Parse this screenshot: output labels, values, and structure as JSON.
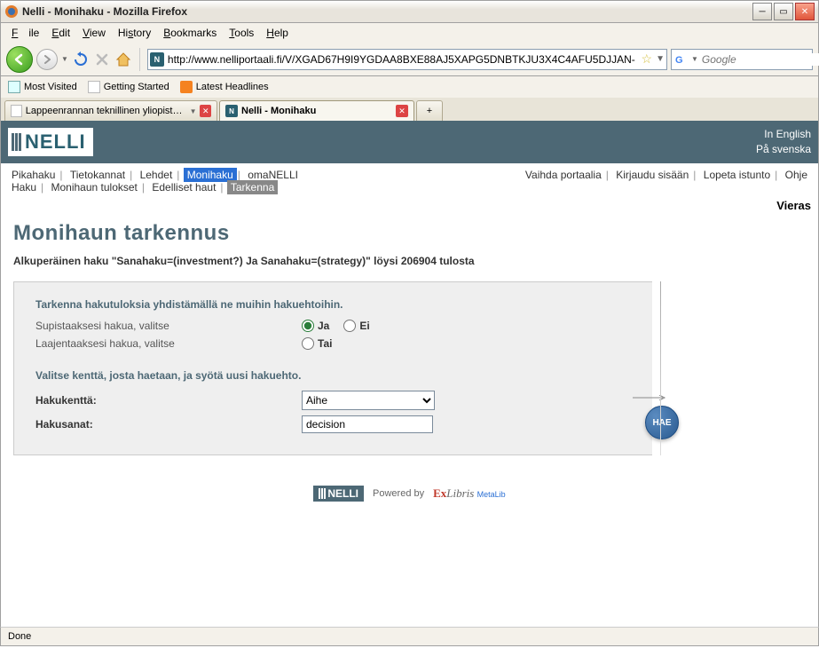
{
  "window": {
    "title": "Nelli - Monihaku - Mozilla Firefox",
    "menus": {
      "file": "File",
      "edit": "Edit",
      "view": "View",
      "history": "History",
      "bookmarks": "Bookmarks",
      "tools": "Tools",
      "help": "Help"
    },
    "url": "http://www.nelliportaali.fi/V/XGAD67H9I9YGDAA8BXE88AJ5XAPG5DNBTKJU3X4C4AFU5DJJAN-",
    "search_placeholder": "Google",
    "bookmarks": {
      "most_visited": "Most Visited",
      "getting_started": "Getting Started",
      "latest_headlines": "Latest Headlines"
    },
    "tabs": {
      "t1": "Lappeenrannan teknillinen yliopisto - Te...",
      "t2": "Nelli - Monihaku"
    },
    "status": "Done"
  },
  "header": {
    "logo": "NELLI",
    "lang_en": "In English",
    "lang_sv": "På svenska"
  },
  "nav": {
    "main": {
      "pikahaku": "Pikahaku",
      "tietokannat": "Tietokannat",
      "lehdet": "Lehdet",
      "monihaku": "Monihaku",
      "omanelli": "omaNELLI"
    },
    "sub": {
      "haku": "Haku",
      "tulokset": "Monihaun tulokset",
      "edelliset": "Edelliset haut",
      "tarkenna": "Tarkenna"
    },
    "right": {
      "vaihda": "Vaihda portaalia",
      "kirjaudu": "Kirjaudu sisään",
      "lopeta": "Lopeta istunto",
      "ohje": "Ohje"
    },
    "user": "Vieras"
  },
  "page": {
    "title": "Monihaun tarkennus",
    "orig": "Alkuperäinen haku \"Sanahaku=(investment?) Ja Sanahaku=(strategy)\" löysi 206904 tulosta",
    "hint1": "Tarkenna hakutuloksia yhdistämällä ne muihin hakuehtoihin.",
    "supista": "Supistaaksesi hakua, valitse",
    "laajentaa": "Laajentaaksesi hakua, valitse",
    "ja": "Ja",
    "ei": "Ei",
    "tai": "Tai",
    "hint2": "Valitse kenttä, josta haetaan, ja syötä uusi hakuehto.",
    "hakukentta_label": "Hakukenttä:",
    "hakukentta_value": "Aihe",
    "hakusanat_label": "Hakusanat:",
    "hakusanat_value": "decision",
    "hae": "HAE"
  },
  "footer": {
    "powered": "Powered by",
    "exlibris_e": "Ex",
    "exlibris_l": "Libris",
    "metalib": "MetaLib"
  }
}
